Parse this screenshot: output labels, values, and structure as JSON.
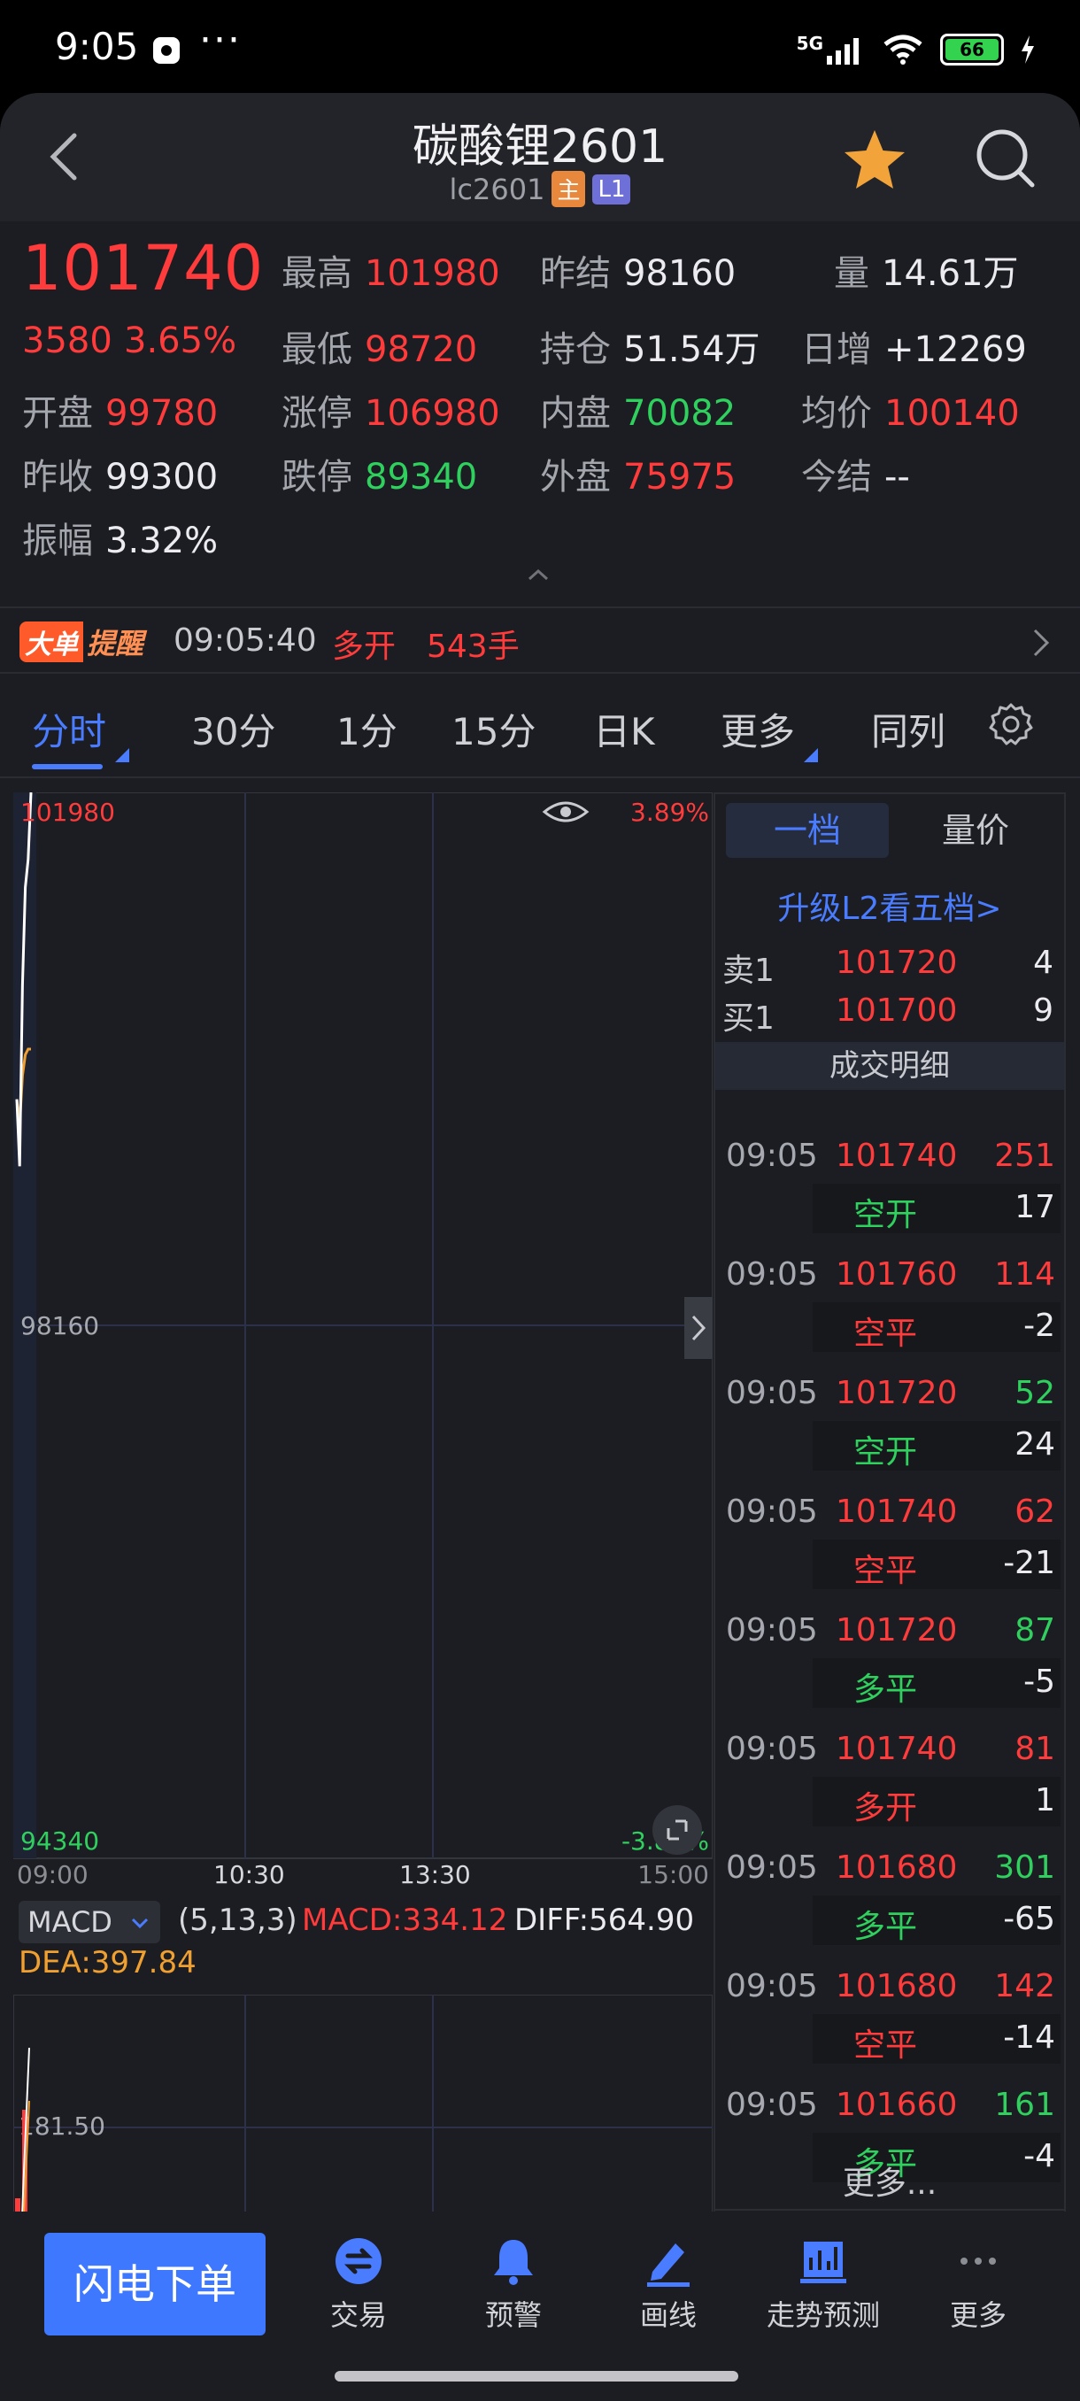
{
  "status_bar": {
    "time": "9:05",
    "dots": "···",
    "network": "5G",
    "battery": "66"
  },
  "header": {
    "title": "碳酸锂2601",
    "code": "lc2601",
    "tag_main": "主",
    "tag_level": "L1"
  },
  "quote": {
    "price": "101740",
    "change": "3580",
    "change_pct": "3.65%",
    "high_label": "最高",
    "high": "101980",
    "low_label": "最低",
    "low": "98720",
    "prev_settle_label": "昨结",
    "prev_settle": "98160",
    "open_interest_label": "持仓",
    "open_interest": "51.54万",
    "volume_label": "量",
    "volume": "14.61万",
    "daily_increase_label": "日增",
    "daily_increase": "+12269",
    "open_label": "开盘",
    "open": "99780",
    "limit_up_label": "涨停",
    "limit_up": "106980",
    "inner_label": "内盘",
    "inner": "70082",
    "avg_label": "均价",
    "avg": "100140",
    "prev_close_label": "昨收",
    "prev_close": "99300",
    "limit_down_label": "跌停",
    "limit_down": "89340",
    "outer_label": "外盘",
    "outer": "75975",
    "today_settle_label": "今结",
    "today_settle": "--",
    "amplitude_label": "振幅",
    "amplitude": "3.32%"
  },
  "alert": {
    "badge_a": "大单",
    "badge_b": "提醒",
    "time": "09:05:40",
    "action": "多开",
    "volume": "543手"
  },
  "tabs": [
    "分时",
    "30分",
    "1分",
    "15分",
    "日K",
    "更多",
    "同列"
  ],
  "chart": {
    "top_price": "101980",
    "top_pct": "3.89%",
    "mid_price": "98160",
    "bottom_price": "94340",
    "bottom_pct": "-3.89%",
    "x_labels": [
      "09:00",
      "10:30",
      "13:30",
      "15:00"
    ],
    "indicator": "MACD",
    "params": "(5,13,3)",
    "macd": "MACD:334.12",
    "diff": "DIFF:564.90",
    "dea": "DEA:397.84",
    "macd_level": "181.50",
    "colors": {
      "price_line": "#ffffff",
      "avg_line": "#f0a030",
      "up": "#ff3b3b"
    }
  },
  "chart_data": {
    "type": "line",
    "x": [
      "09:00",
      "09:01",
      "09:02",
      "09:03",
      "09:04",
      "09:05"
    ],
    "series": [
      {
        "values": [
          99780,
          99300,
          100600,
          101300,
          101500,
          101980
        ]
      },
      {
        "values": [
          99780,
          99600,
          99950,
          100100,
          100140,
          100140
        ]
      }
    ],
    "ylim": [
      94340,
      101980
    ],
    "y_ticks": [
      "101980",
      "98160",
      "94340"
    ],
    "x_ticks": [
      "09:00",
      "10:30",
      "13:30",
      "15:00"
    ]
  },
  "side": {
    "tab_l1": "一档",
    "tab_vp": "量价",
    "upgrade": "升级L2看五档>",
    "ask_label": "卖1",
    "ask_price": "101720",
    "ask_vol": "4",
    "bid_label": "买1",
    "bid_price": "101700",
    "bid_vol": "9",
    "section": "成交明细",
    "trades": [
      {
        "time": "09:05",
        "price": "101740",
        "vol": "251",
        "type": "空开",
        "delta": "17",
        "vol_color": "red",
        "type_color": "green"
      },
      {
        "time": "09:05",
        "price": "101760",
        "vol": "114",
        "type": "空平",
        "delta": "-2",
        "vol_color": "red",
        "type_color": "red"
      },
      {
        "time": "09:05",
        "price": "101720",
        "vol": "52",
        "type": "空开",
        "delta": "24",
        "vol_color": "green",
        "type_color": "green"
      },
      {
        "time": "09:05",
        "price": "101740",
        "vol": "62",
        "type": "空平",
        "delta": "-21",
        "vol_color": "red",
        "type_color": "red"
      },
      {
        "time": "09:05",
        "price": "101720",
        "vol": "87",
        "type": "多平",
        "delta": "-5",
        "vol_color": "green",
        "type_color": "green"
      },
      {
        "time": "09:05",
        "price": "101740",
        "vol": "81",
        "type": "多开",
        "delta": "1",
        "vol_color": "red",
        "type_color": "red"
      },
      {
        "time": "09:05",
        "price": "101680",
        "vol": "301",
        "type": "多平",
        "delta": "-65",
        "vol_color": "green",
        "type_color": "green"
      },
      {
        "time": "09:05",
        "price": "101680",
        "vol": "142",
        "type": "空平",
        "delta": "-14",
        "vol_color": "red",
        "type_color": "red"
      },
      {
        "time": "09:05",
        "price": "101660",
        "vol": "161",
        "type": "多平",
        "delta": "-4",
        "vol_color": "green",
        "type_color": "green"
      }
    ],
    "more": "更多..."
  },
  "bottom": {
    "flash_order": "闪电下单",
    "items": [
      "交易",
      "预警",
      "画线",
      "走势预测",
      "更多"
    ]
  }
}
